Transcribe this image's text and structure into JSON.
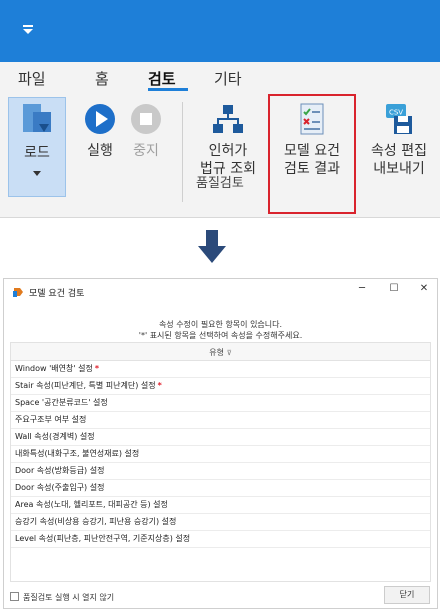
{
  "ribbon": {
    "tabs": [
      "파일",
      "홈",
      "검토",
      "기타"
    ],
    "active_tab": "검토",
    "buttons": {
      "load": "로드",
      "run": "실행",
      "stop": "중지",
      "permit_line1": "인허가",
      "permit_line2": "법규 조회",
      "model_line1": "모델 요건",
      "model_line2": "검토 결과",
      "export_line1": "속성 편집",
      "export_line2": "내보내기"
    },
    "group_label": "품질검토",
    "csv_badge": "CSV"
  },
  "dialog": {
    "title": "모델 요건 검토",
    "win_min": "─",
    "win_max": "☐",
    "win_close": "✕",
    "notice_line1": "속성 수정이 필요한 항목이 있습니다.",
    "notice_line2": "'*' 표시된 항목을 선택하여 속성을 수정해주세요.",
    "column_header": "유형",
    "filter_glyph": "⊽",
    "items": [
      {
        "label": "Window '배연창' 설정",
        "required": "*"
      },
      {
        "label": "Stair 속성(피난계단, 특별 피난계단) 설정",
        "required": "*"
      },
      {
        "label": "Space '공간분류코드' 설정",
        "required": ""
      },
      {
        "label": "주요구조부 여부 설정",
        "required": ""
      },
      {
        "label": "Wall 속성(경계벽) 설정",
        "required": ""
      },
      {
        "label": "내화특성(내화구조, 불연성재료) 설정",
        "required": ""
      },
      {
        "label": "Door 속성(방화등급) 설정",
        "required": ""
      },
      {
        "label": "Door 속성(주출입구) 설정",
        "required": ""
      },
      {
        "label": "Area 속성(노대, 헬리포트, 대피공간 등) 설정",
        "required": ""
      },
      {
        "label": "승강기 속성(비상용 승강기, 피난용 승강기) 설정",
        "required": ""
      },
      {
        "label": "Level 속성(피난층, 피난안전구역, 기준지상층) 설정",
        "required": ""
      }
    ],
    "footer_checkbox_label": "품질검토 실행 시 열지 않기",
    "footer_checkbox_checked": false,
    "close_label": "닫기"
  },
  "colors": {
    "accent": "#1e7fd8",
    "highlight": "#d9232d",
    "required_mark": "#e0202c"
  }
}
